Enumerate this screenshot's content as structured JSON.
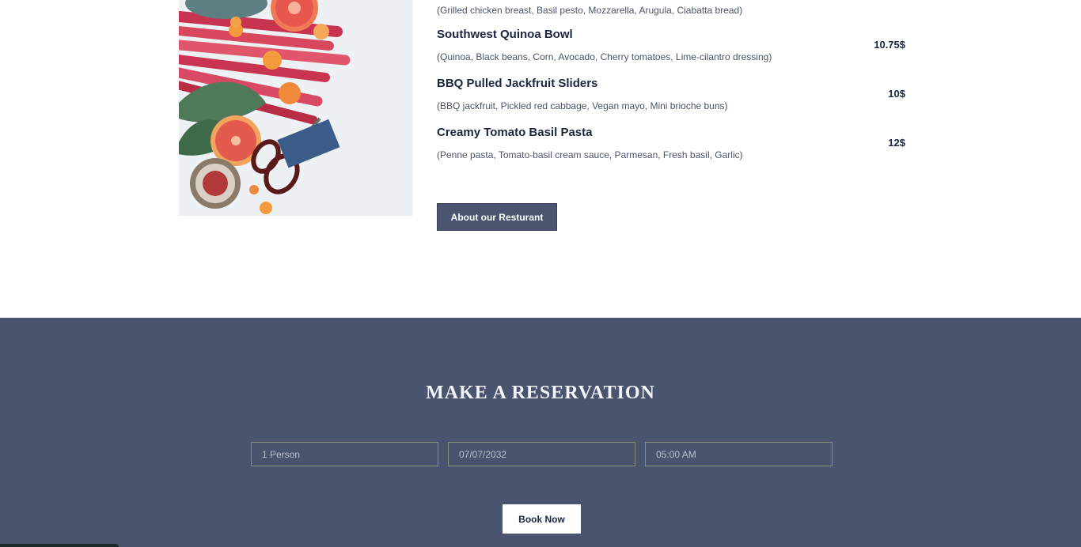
{
  "menu": {
    "partial_item": {
      "description": "(Grilled chicken breast, Basil pesto, Mozzarella, Arugula, Ciabatta bread)"
    },
    "items": [
      {
        "name": "Southwest Quinoa Bowl",
        "description": "(Quinoa, Black beans, Corn, Avocado, Cherry tomatoes, Lime-cilantro dressing)",
        "price": "10.75$"
      },
      {
        "name": "BBQ Pulled Jackfruit Sliders",
        "description": "(BBQ jackfruit, Pickled red cabbage, Vegan mayo, Mini brioche buns)",
        "price": "10$"
      },
      {
        "name": "Creamy Tomato Basil Pasta",
        "description": "(Penne pasta, Tomato-basil cream sauce, Parmesan, Fresh basil, Garlic)",
        "price": "12$"
      }
    ],
    "about_button_label": "About our Resturant"
  },
  "reservation": {
    "title": "MAKE A RESERVATION",
    "fields": {
      "persons": "1 Person",
      "date": "07/07/2032",
      "time": "05:00 AM"
    },
    "book_button_label": "Book Now"
  },
  "colors": {
    "reservation_bg": "#4b546e",
    "button_dark": "#4b5570",
    "text_dark": "#1c2541"
  }
}
